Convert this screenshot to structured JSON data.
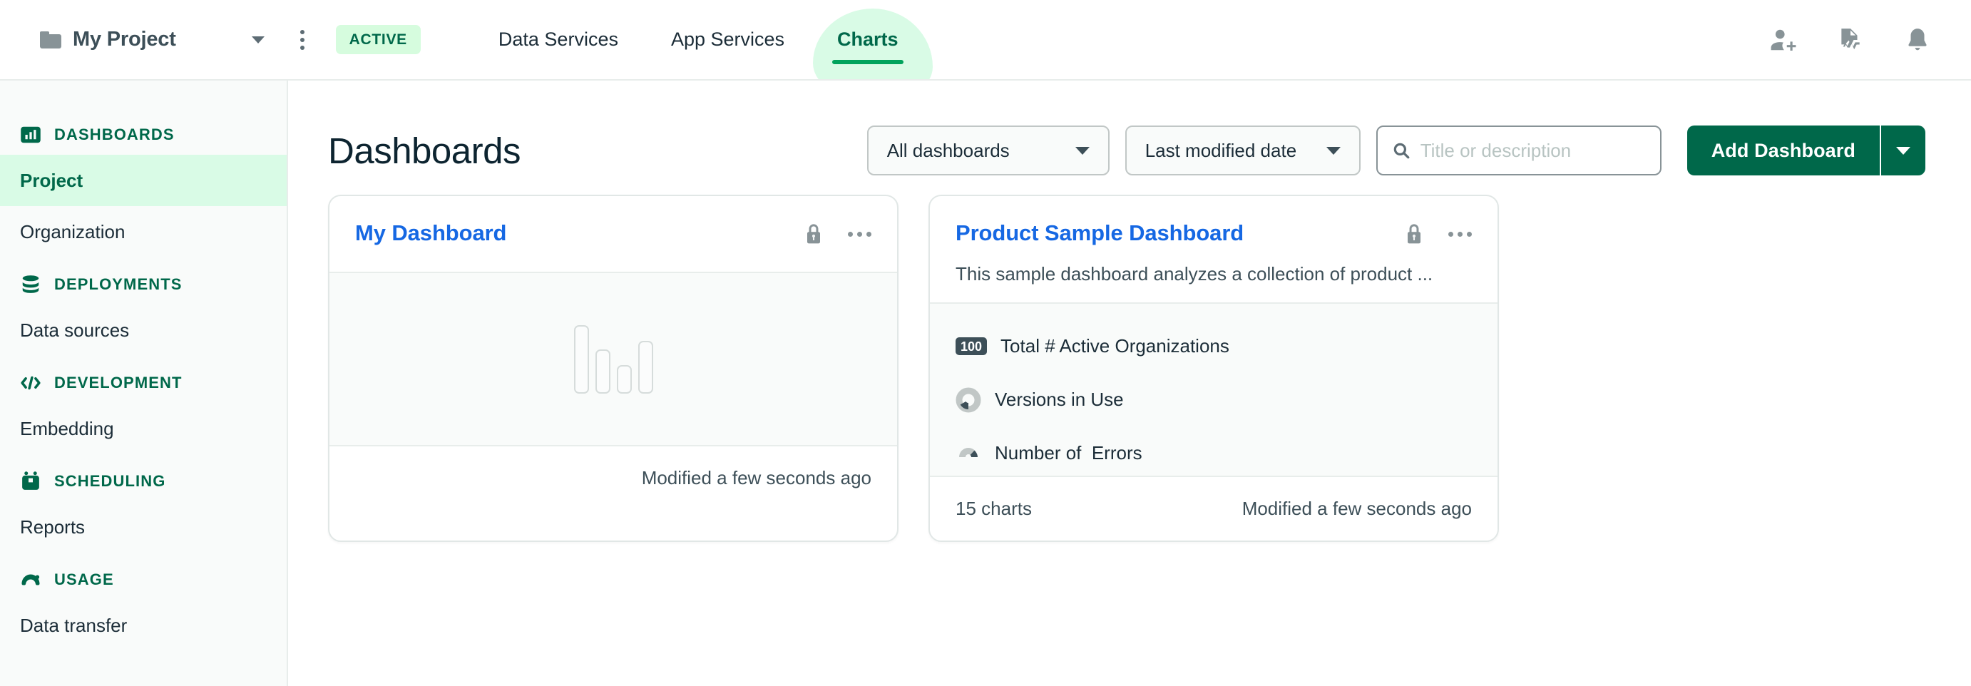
{
  "topbar": {
    "project_name": "My Project",
    "status_badge": "ACTIVE",
    "tabs": [
      {
        "label": "Data Services",
        "active": false
      },
      {
        "label": "App Services",
        "active": false
      },
      {
        "label": "Charts",
        "active": true
      }
    ],
    "icons": [
      "invite-user-icon",
      "activity-feed-icon",
      "notification-bell-icon"
    ]
  },
  "sidebar": {
    "sections": [
      {
        "label": "DASHBOARDS",
        "icon": "bar-chart-icon",
        "items": [
          {
            "label": "Project",
            "active": true
          },
          {
            "label": "Organization",
            "active": false
          }
        ]
      },
      {
        "label": "DEPLOYMENTS",
        "icon": "database-icon",
        "items": [
          {
            "label": "Data sources",
            "active": false
          }
        ]
      },
      {
        "label": "DEVELOPMENT",
        "icon": "code-brackets-icon",
        "items": [
          {
            "label": "Embedding",
            "active": false
          }
        ]
      },
      {
        "label": "SCHEDULING",
        "icon": "calendar-icon",
        "items": [
          {
            "label": "Reports",
            "active": false
          }
        ]
      },
      {
        "label": "USAGE",
        "icon": "gauge-icon",
        "items": [
          {
            "label": "Data transfer",
            "active": false
          }
        ]
      }
    ]
  },
  "main": {
    "page_title": "Dashboards",
    "filter_dashboards": "All dashboards",
    "filter_sort": "Last modified date",
    "search_placeholder": "Title or description",
    "search_value": "",
    "add_dashboard_label": "Add Dashboard"
  },
  "cards": [
    {
      "title": "My Dashboard",
      "description": "",
      "has_description": false,
      "empty_state": true,
      "empty_bars": [
        96,
        62,
        40,
        74
      ],
      "charts": [],
      "chart_count": "",
      "modified": "Modified a few seconds ago"
    },
    {
      "title": "Product Sample Dashboard",
      "description": "This sample dashboard analyzes a collection of product ...",
      "has_description": true,
      "empty_state": false,
      "empty_bars": [],
      "charts": [
        {
          "label": "Total # Active Organizations",
          "icon": "number-badge-icon",
          "badge": "100"
        },
        {
          "label": "Versions in Use",
          "icon": "donut-chart-icon",
          "badge": ""
        },
        {
          "label": "Number of  Errors",
          "icon": "gauge-chart-icon",
          "badge": ""
        }
      ],
      "chart_count": "15 charts",
      "modified": "Modified a few seconds ago"
    }
  ],
  "colors": {
    "brand_green": "#00684a",
    "accent_green": "#00a35c",
    "highlight_mint": "#d9fbe6",
    "link_blue": "#1668e3",
    "text_dark": "#1c2d38",
    "text_muted": "#3d4f58",
    "icon_gray": "#889397"
  }
}
